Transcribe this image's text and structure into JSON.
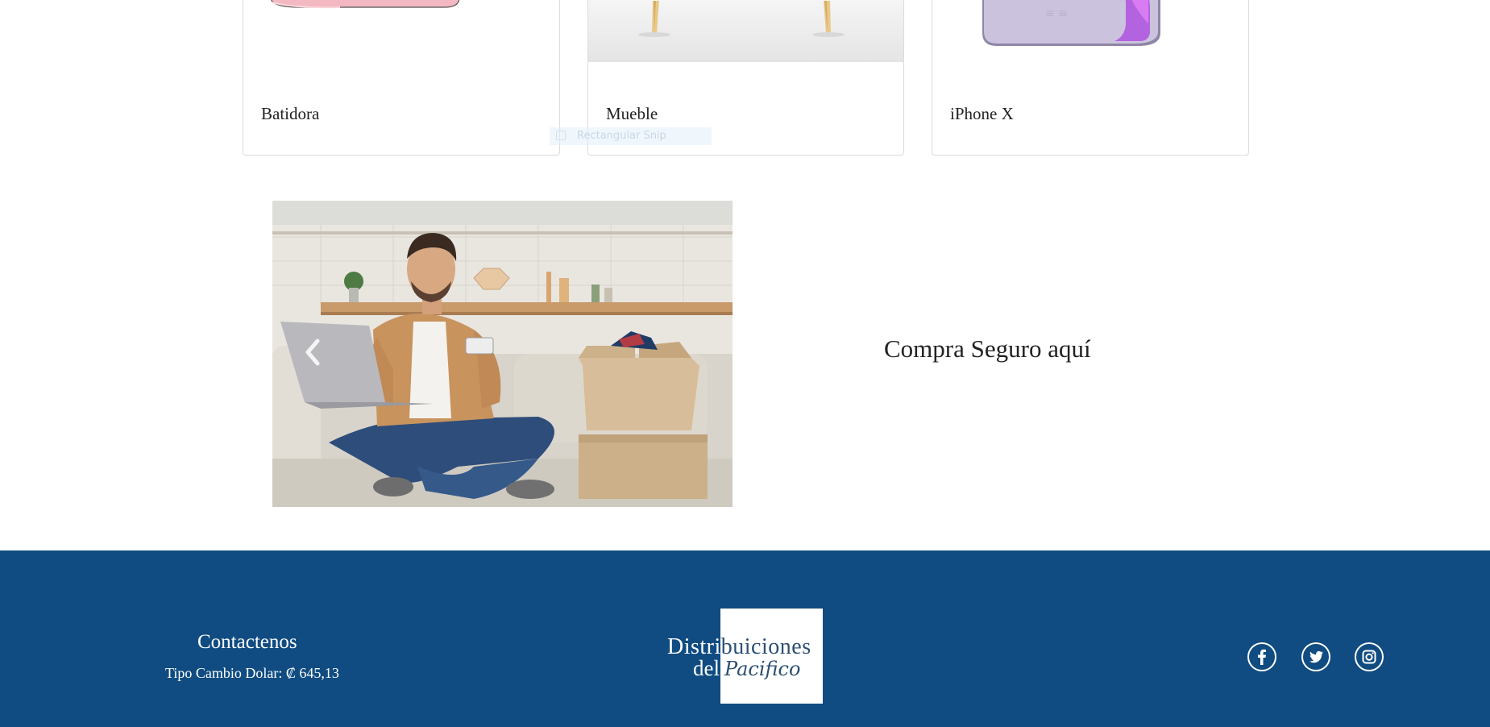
{
  "products": [
    {
      "name": "Batidora",
      "image_icon": "mixer-image"
    },
    {
      "name": "Mueble",
      "image_icon": "chair-image"
    },
    {
      "name": "iPhone X",
      "image_icon": "phone-image"
    }
  ],
  "overlay": {
    "label": "Rectangular Snip"
  },
  "promo": {
    "heading": "Compra Seguro aquí",
    "carousel_image": "man-online-shopping-photo",
    "prev_icon": "chevron-left-icon"
  },
  "footer": {
    "background": "#104c81",
    "contact_title": "Contactenos",
    "exchange_rate": "Tipo Cambio Dolar: ₡ 645,13",
    "logo": {
      "line1_a": "Distri",
      "line1_b": "buiciones",
      "line2_a": "del",
      "line2_b": "Pacifico"
    },
    "social": [
      {
        "name": "facebook-icon"
      },
      {
        "name": "twitter-icon"
      },
      {
        "name": "instagram-icon"
      }
    ]
  }
}
